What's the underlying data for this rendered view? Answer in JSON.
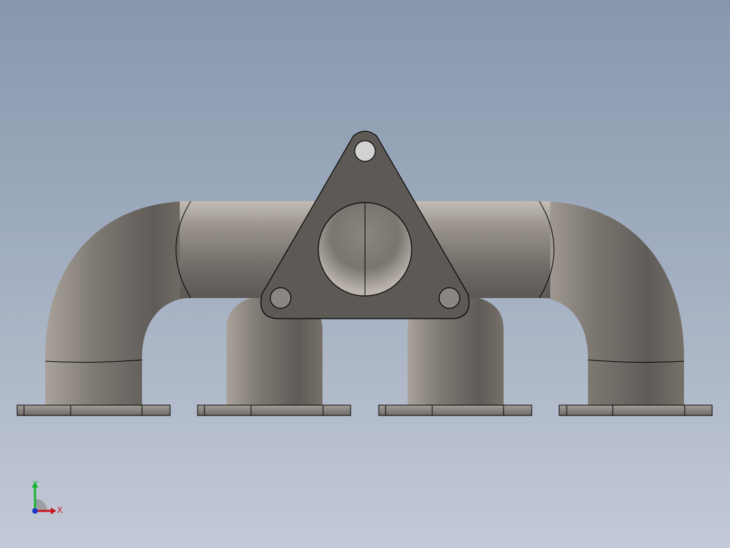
{
  "viewport": {
    "triad": {
      "x_label": "X",
      "y_label": "Y",
      "x_color": "#c8141e",
      "y_color": "#14b432",
      "z_color": "#1e32c8"
    },
    "colors": {
      "background_top": "#8797ad",
      "background_bottom": "#c3c9d6",
      "model_surface": "#86807a",
      "model_dark": "#5a5551",
      "outline": "#000000"
    }
  }
}
